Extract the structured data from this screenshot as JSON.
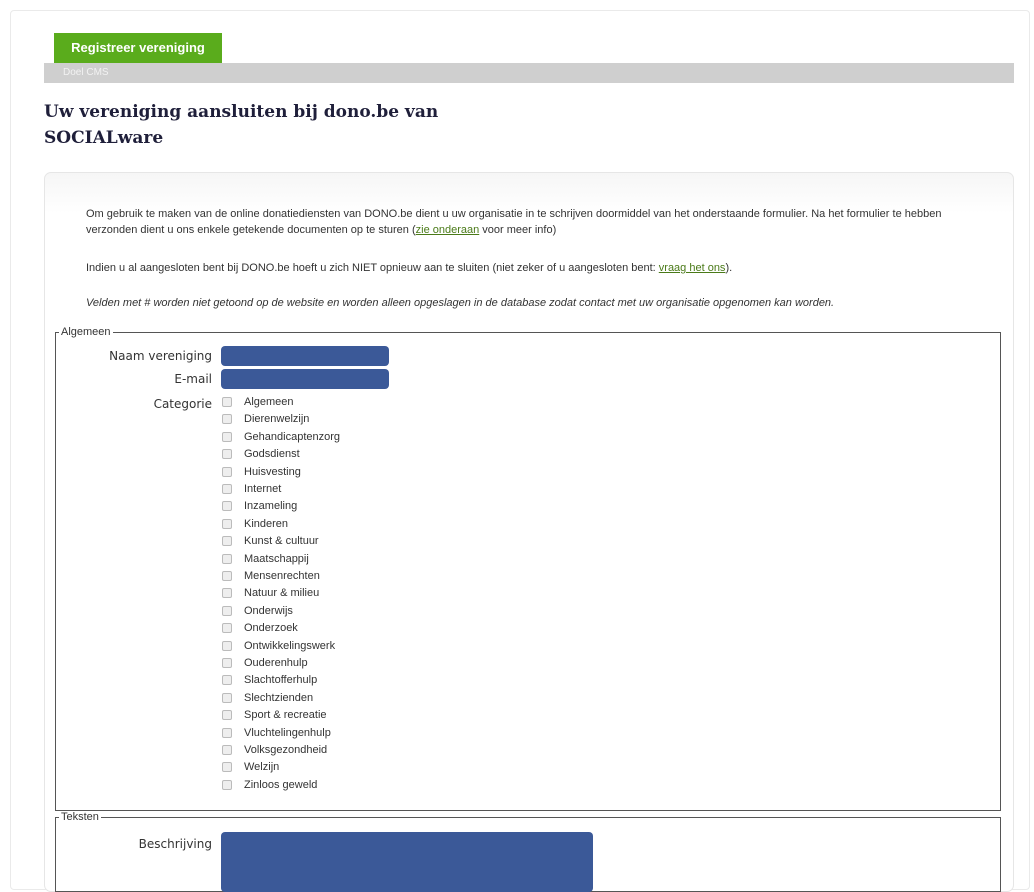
{
  "tab": {
    "label": "Registreer vereniging"
  },
  "subbar": {
    "label": "Doel CMS"
  },
  "title": "Uw vereniging aansluiten bij dono.be van SOCIALware",
  "intro": {
    "p1_text": "Om gebruik te maken van de online donatiediensten van DONO.be dient u uw organisatie in te schrijven doormiddel van het onderstaande formulier. Na het formulier te hebben verzonden dient u ons enkele getekende documenten op te sturen (",
    "p1_link": "zie onderaan",
    "p1_end": " voor meer info)",
    "p2_text": "Indien u al aangesloten bent bij DONO.be hoeft u zich NIET opnieuw aan te sluiten (niet zeker of u aangesloten bent: ",
    "p2_link": "vraag het ons",
    "p2_end": ").",
    "p3_text": "Velden met # worden niet getoond op de website en worden alleen opgeslagen in de database zodat contact met uw organisatie opgenomen kan worden."
  },
  "algemeen": {
    "legend": "Algemeen",
    "naam_label": "Naam vereniging",
    "naam_value": "",
    "email_label": "E-mail",
    "email_value": "",
    "categorie_label": "Categorie",
    "categories": [
      "Algemeen",
      "Dierenwelzijn",
      "Gehandicaptenzorg",
      "Godsdienst",
      "Huisvesting",
      "Internet",
      "Inzameling",
      "Kinderen",
      "Kunst & cultuur",
      "Maatschappij",
      "Mensenrechten",
      "Natuur & milieu",
      "Onderwijs",
      "Onderzoek",
      "Ontwikkelingswerk",
      "Ouderenhulp",
      "Slachtofferhulp",
      "Slechtzienden",
      "Sport & recreatie",
      "Vluchtelingenhulp",
      "Volksgezondheid",
      "Welzijn",
      "Zinloos geweld"
    ]
  },
  "teksten": {
    "legend": "Teksten",
    "beschrijving_label": "Beschrijving",
    "beschrijving_value": ""
  },
  "colors": {
    "tab_green": "#5aac1c",
    "input_blue": "#3b5998",
    "subbar_gray": "#cfcfcf",
    "link_green": "#4a7a18"
  }
}
